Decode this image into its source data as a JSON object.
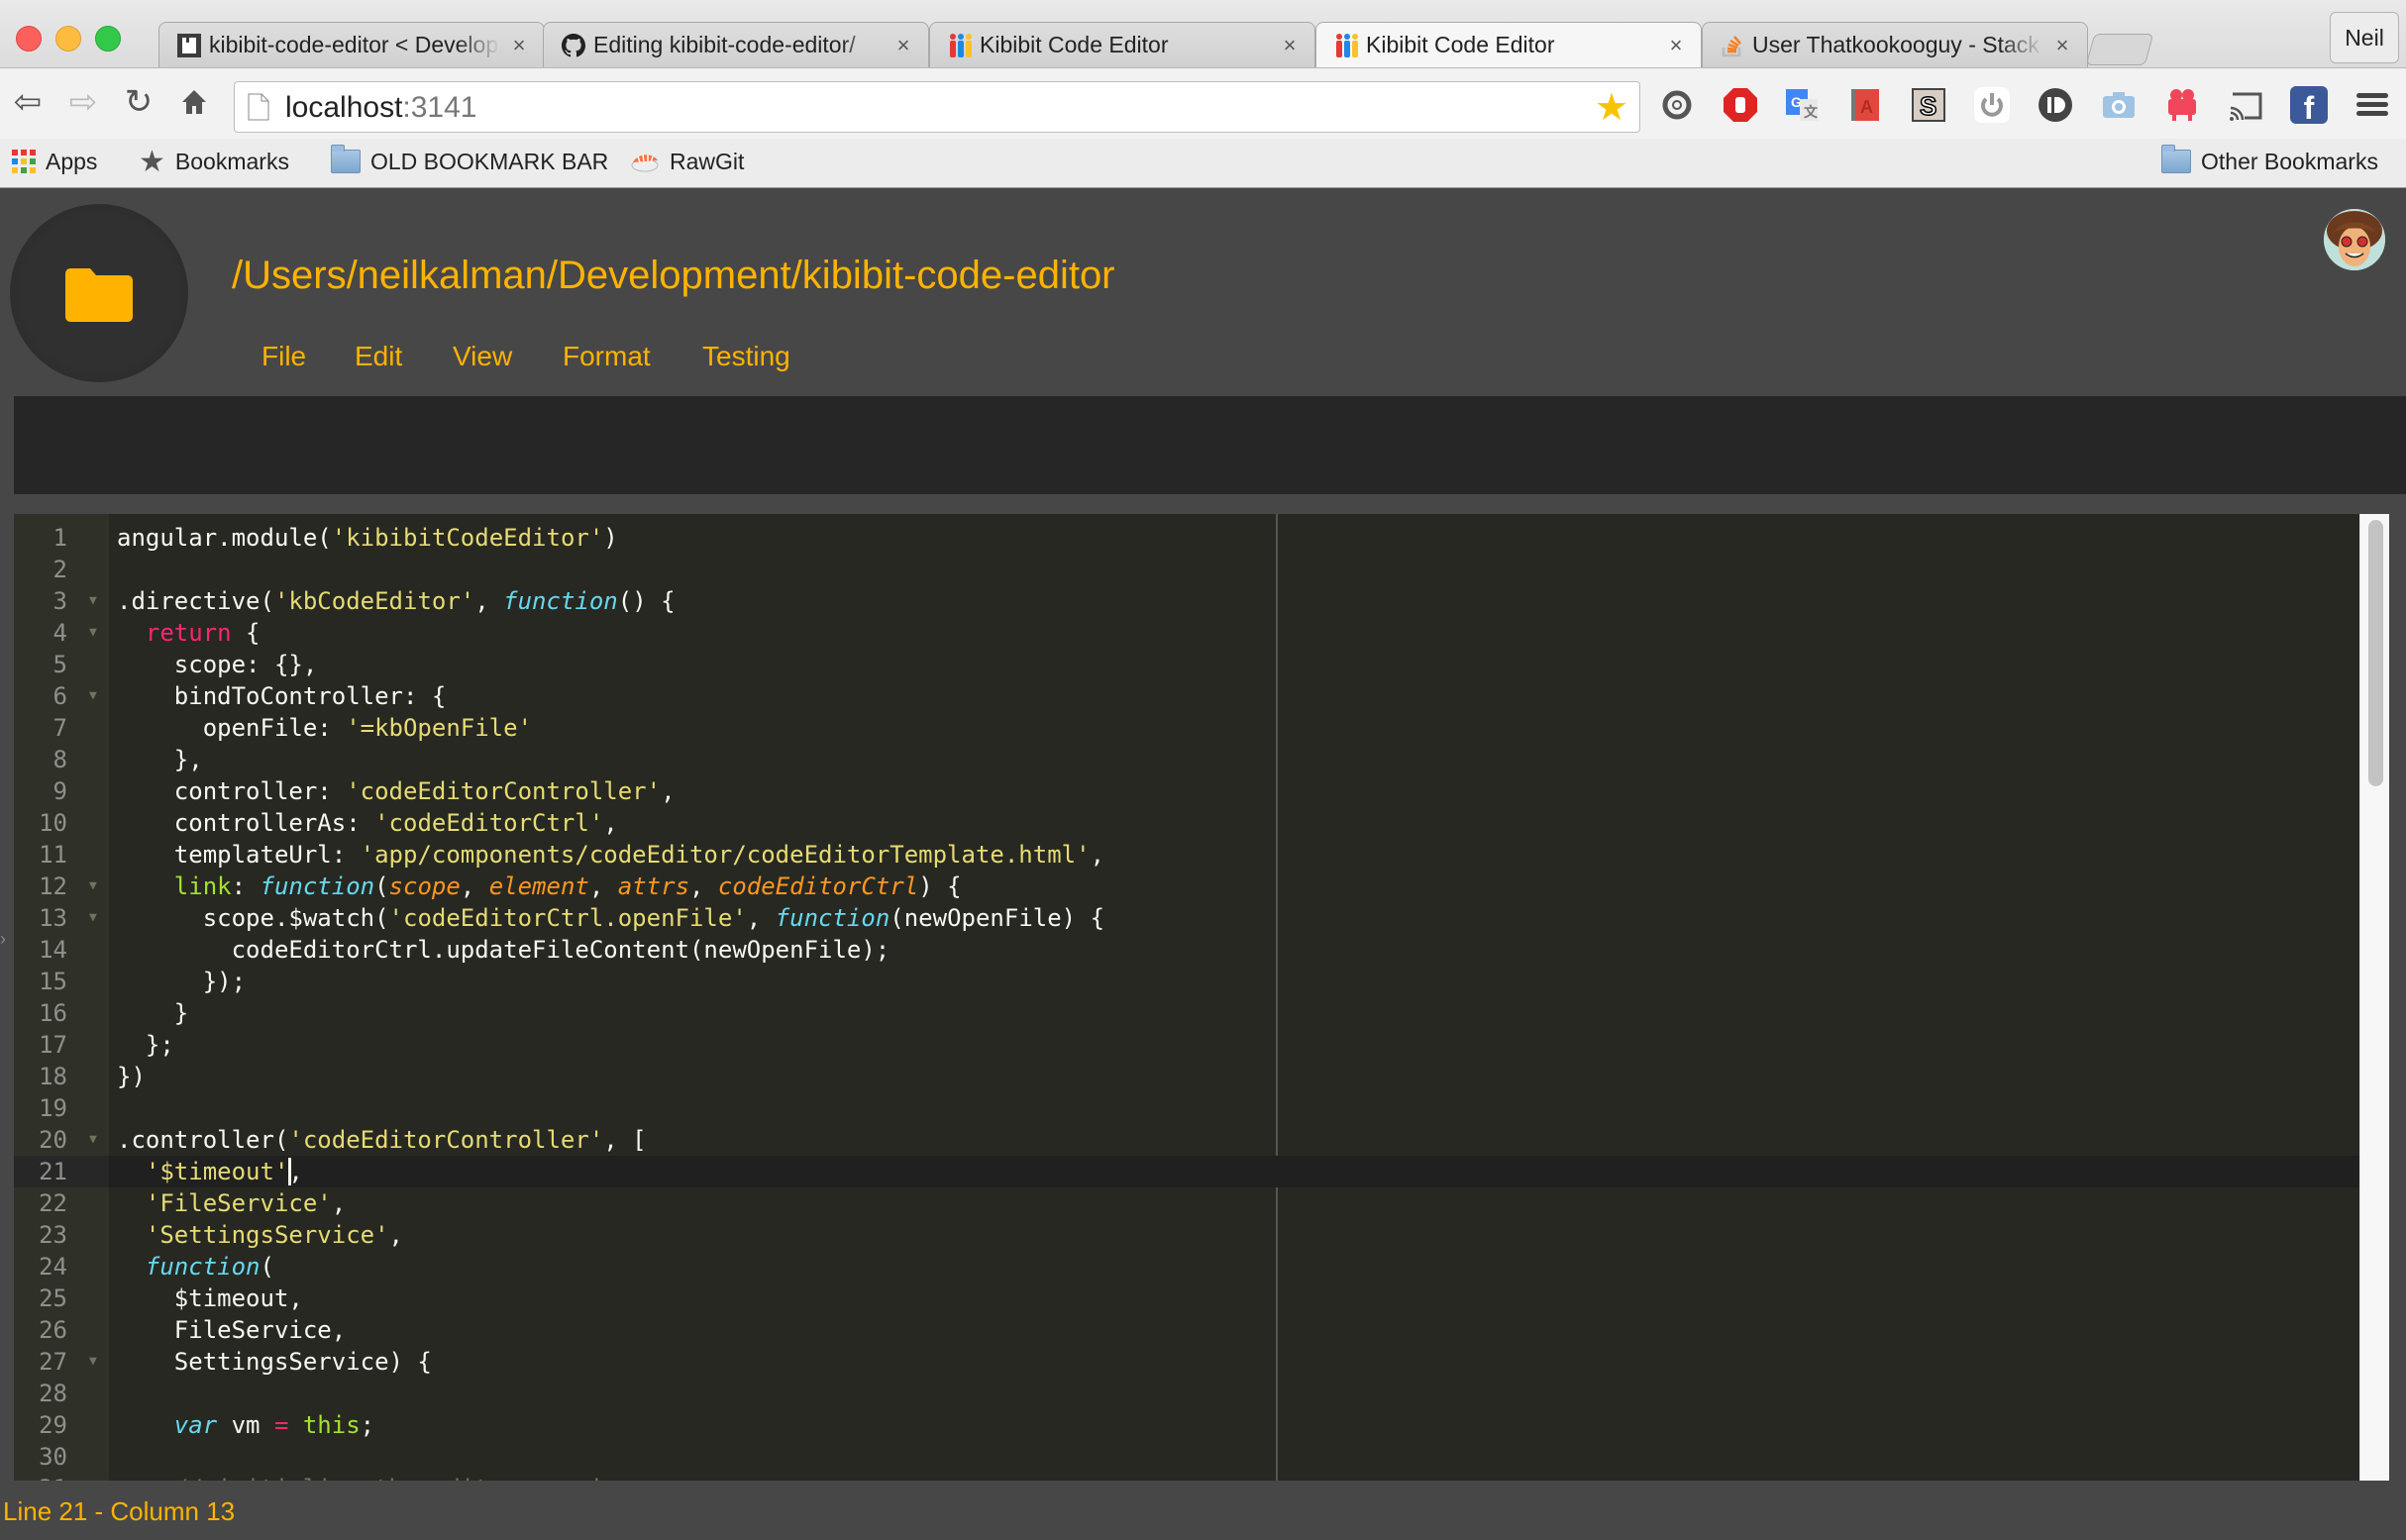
{
  "browser": {
    "window_controls": {
      "close_color": "#fc605c",
      "minimize_color": "#fdbc40",
      "maximize_color": "#34c84a"
    },
    "tabs": [
      {
        "title": "kibibit-code-editor < Development",
        "icon": "folder-page-icon",
        "active": false
      },
      {
        "title": "Editing kibibit-code-editor/",
        "icon": "github-icon",
        "active": false
      },
      {
        "title": "Kibibit Code Editor",
        "icon": "kibibit-icon",
        "active": false
      },
      {
        "title": "Kibibit Code Editor",
        "icon": "kibibit-icon",
        "active": true
      },
      {
        "title": "User Thatkookooguy - Stack Overflow",
        "icon": "stackoverflow-icon",
        "active": false
      }
    ],
    "tab_close_glyph": "×",
    "profile_name": "Neil",
    "nav": {
      "back": "back-arrow-icon",
      "forward": "forward-arrow-icon",
      "reload": "reload-icon",
      "home": "home-icon"
    },
    "address": {
      "host": "localhost",
      "port": ":3141"
    },
    "extensions": [
      "sync-icon",
      "adblock-icon",
      "google-translate-icon",
      "dictionary-icon",
      "s-extension-icon",
      "power-icon",
      "d-extension-icon",
      "camera-icon",
      "video-recorder-icon",
      "cast-icon",
      "facebook-icon"
    ],
    "bookmarks": [
      {
        "label": "Apps",
        "icon": "apps-grid-icon"
      },
      {
        "label": "Bookmarks",
        "icon": "star-icon"
      },
      {
        "label": "OLD BOOKMARK BAR",
        "icon": "folder-icon"
      },
      {
        "label": "RawGit",
        "icon": "sushi-icon"
      }
    ],
    "other_bookmarks": "Other Bookmarks"
  },
  "app": {
    "accent_color": "#ffb300",
    "project_path": "/Users/neilkalman/Development/kibibit-code-editor",
    "menu": [
      "File",
      "Edit",
      "View",
      "Format",
      "Testing"
    ],
    "user_avatar": "avatar"
  },
  "editor": {
    "theme": "monokai",
    "cursor": {
      "line": 21,
      "column": 13
    },
    "scroll_fraction_visible": 0.28,
    "fold_lines": [
      3,
      4,
      6,
      12,
      13,
      20,
      27
    ],
    "lines": [
      [
        [
          "plain",
          "angular.module("
        ],
        [
          "str",
          "'kibibitCodeEditor'"
        ],
        [
          "plain",
          ")"
        ]
      ],
      [],
      [
        [
          "plain",
          ".directive("
        ],
        [
          "str",
          "'kbCodeEditor'"
        ],
        [
          "plain",
          ", "
        ],
        [
          "fn",
          "function"
        ],
        [
          "plain",
          "() {"
        ]
      ],
      [
        [
          "plain",
          "  "
        ],
        [
          "kw",
          "return"
        ],
        [
          "plain",
          " {"
        ]
      ],
      [
        [
          "plain",
          "    scope: {},"
        ]
      ],
      [
        [
          "plain",
          "    bindToController: {"
        ]
      ],
      [
        [
          "plain",
          "      openFile: "
        ],
        [
          "str",
          "'=kbOpenFile'"
        ]
      ],
      [
        [
          "plain",
          "    },"
        ]
      ],
      [
        [
          "plain",
          "    controller: "
        ],
        [
          "str",
          "'codeEditorController'"
        ],
        [
          "plain",
          ","
        ]
      ],
      [
        [
          "plain",
          "    controllerAs: "
        ],
        [
          "str",
          "'codeEditorCtrl'"
        ],
        [
          "plain",
          ","
        ]
      ],
      [
        [
          "plain",
          "    templateUrl: "
        ],
        [
          "str",
          "'app/components/codeEditor/codeEditorTemplate.html'"
        ],
        [
          "plain",
          ","
        ]
      ],
      [
        [
          "plain",
          "    "
        ],
        [
          "prop",
          "link"
        ],
        [
          "plain",
          ": "
        ],
        [
          "fn",
          "function"
        ],
        [
          "plain",
          "("
        ],
        [
          "param",
          "scope"
        ],
        [
          "plain",
          ", "
        ],
        [
          "param",
          "element"
        ],
        [
          "plain",
          ", "
        ],
        [
          "param",
          "attrs"
        ],
        [
          "plain",
          ", "
        ],
        [
          "param",
          "codeEditorCtrl"
        ],
        [
          "plain",
          ") {"
        ]
      ],
      [
        [
          "plain",
          "      scope.$watch("
        ],
        [
          "str",
          "'codeEditorCtrl.openFile'"
        ],
        [
          "plain",
          ", "
        ],
        [
          "fn",
          "function"
        ],
        [
          "plain",
          "(newOpenFile) {"
        ]
      ],
      [
        [
          "plain",
          "        codeEditorCtrl.updateFileContent(newOpenFile);"
        ]
      ],
      [
        [
          "plain",
          "      });"
        ]
      ],
      [
        [
          "plain",
          "    }"
        ]
      ],
      [
        [
          "plain",
          "  };"
        ]
      ],
      [
        [
          "plain",
          "})"
        ]
      ],
      [],
      [
        [
          "plain",
          ".controller("
        ],
        [
          "str",
          "'codeEditorController'"
        ],
        [
          "plain",
          ", ["
        ]
      ],
      [
        [
          "plain",
          "  "
        ],
        [
          "str",
          "'$timeout'"
        ],
        [
          "plain",
          ","
        ]
      ],
      [
        [
          "plain",
          "  "
        ],
        [
          "str",
          "'FileService'"
        ],
        [
          "plain",
          ","
        ]
      ],
      [
        [
          "plain",
          "  "
        ],
        [
          "str",
          "'SettingsService'"
        ],
        [
          "plain",
          ","
        ]
      ],
      [
        [
          "plain",
          "  "
        ],
        [
          "fn",
          "function"
        ],
        [
          "plain",
          "("
        ]
      ],
      [
        [
          "plain",
          "    $timeout,"
        ]
      ],
      [
        [
          "plain",
          "    FileService,"
        ]
      ],
      [
        [
          "plain",
          "    SettingsService) {"
        ]
      ],
      [],
      [
        [
          "plain",
          "    "
        ],
        [
          "fn",
          "var"
        ],
        [
          "plain",
          " vm "
        ],
        [
          "kw",
          "="
        ],
        [
          "plain",
          " "
        ],
        [
          "prop",
          "this"
        ],
        [
          "plain",
          ";"
        ]
      ],
      [],
      [
        [
          "plain",
          "    "
        ],
        [
          "com",
          "// initialize the editor session"
        ]
      ]
    ]
  },
  "status": {
    "text": "Line 21 - Column 13"
  }
}
